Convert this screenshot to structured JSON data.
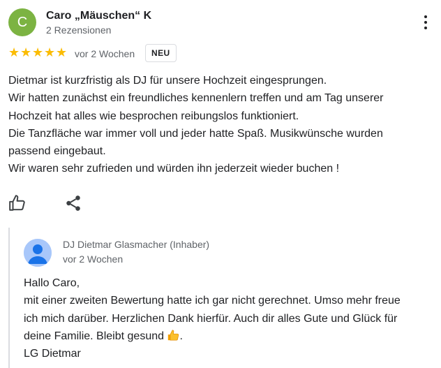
{
  "review": {
    "avatar_letter": "C",
    "avatar_color": "#7cb342",
    "author_name": "Caro „Mäuschen“ K",
    "author_reviews": "2 Rezensionen",
    "rating_stars": 5,
    "star_glyph": "★",
    "time": "vor 2 Wochen",
    "badge": "NEU",
    "text_lines": [
      "Dietmar ist kurzfristig als DJ für unsere Hochzeit eingesprungen.",
      "Wir hatten zunächst ein freundliches kennenlern treffen und am Tag unserer",
      "Hochzeit hat alles wie besprochen reibungslos funktioniert.",
      "Die Tanzfläche war immer voll und jeder hatte Spaß. Musikwünsche wurden",
      "passend eingebaut.",
      "Wir waren sehr zufrieden und würden ihn jederzeit wieder buchen !"
    ]
  },
  "actions": {
    "like_icon": "thumbs-up-icon",
    "share_icon": "share-icon"
  },
  "owner_reply": {
    "owner_name": "DJ Dietmar Glasmacher (Inhaber)",
    "time": "vor 2 Wochen",
    "text_lines": [
      "Hallo Caro,",
      "mit einer zweiten Bewertung hatte ich gar nicht gerechnet. Umso mehr freue",
      "ich mich darüber. Herzlichen Dank hierfür. Auch dir alles Gute und Glück für",
      "deine Familie. Bleibt gesund"
    ],
    "line4_suffix": ".",
    "closing": "LG Dietmar",
    "emoji_icon": "thumbs-up-emoji-icon"
  }
}
